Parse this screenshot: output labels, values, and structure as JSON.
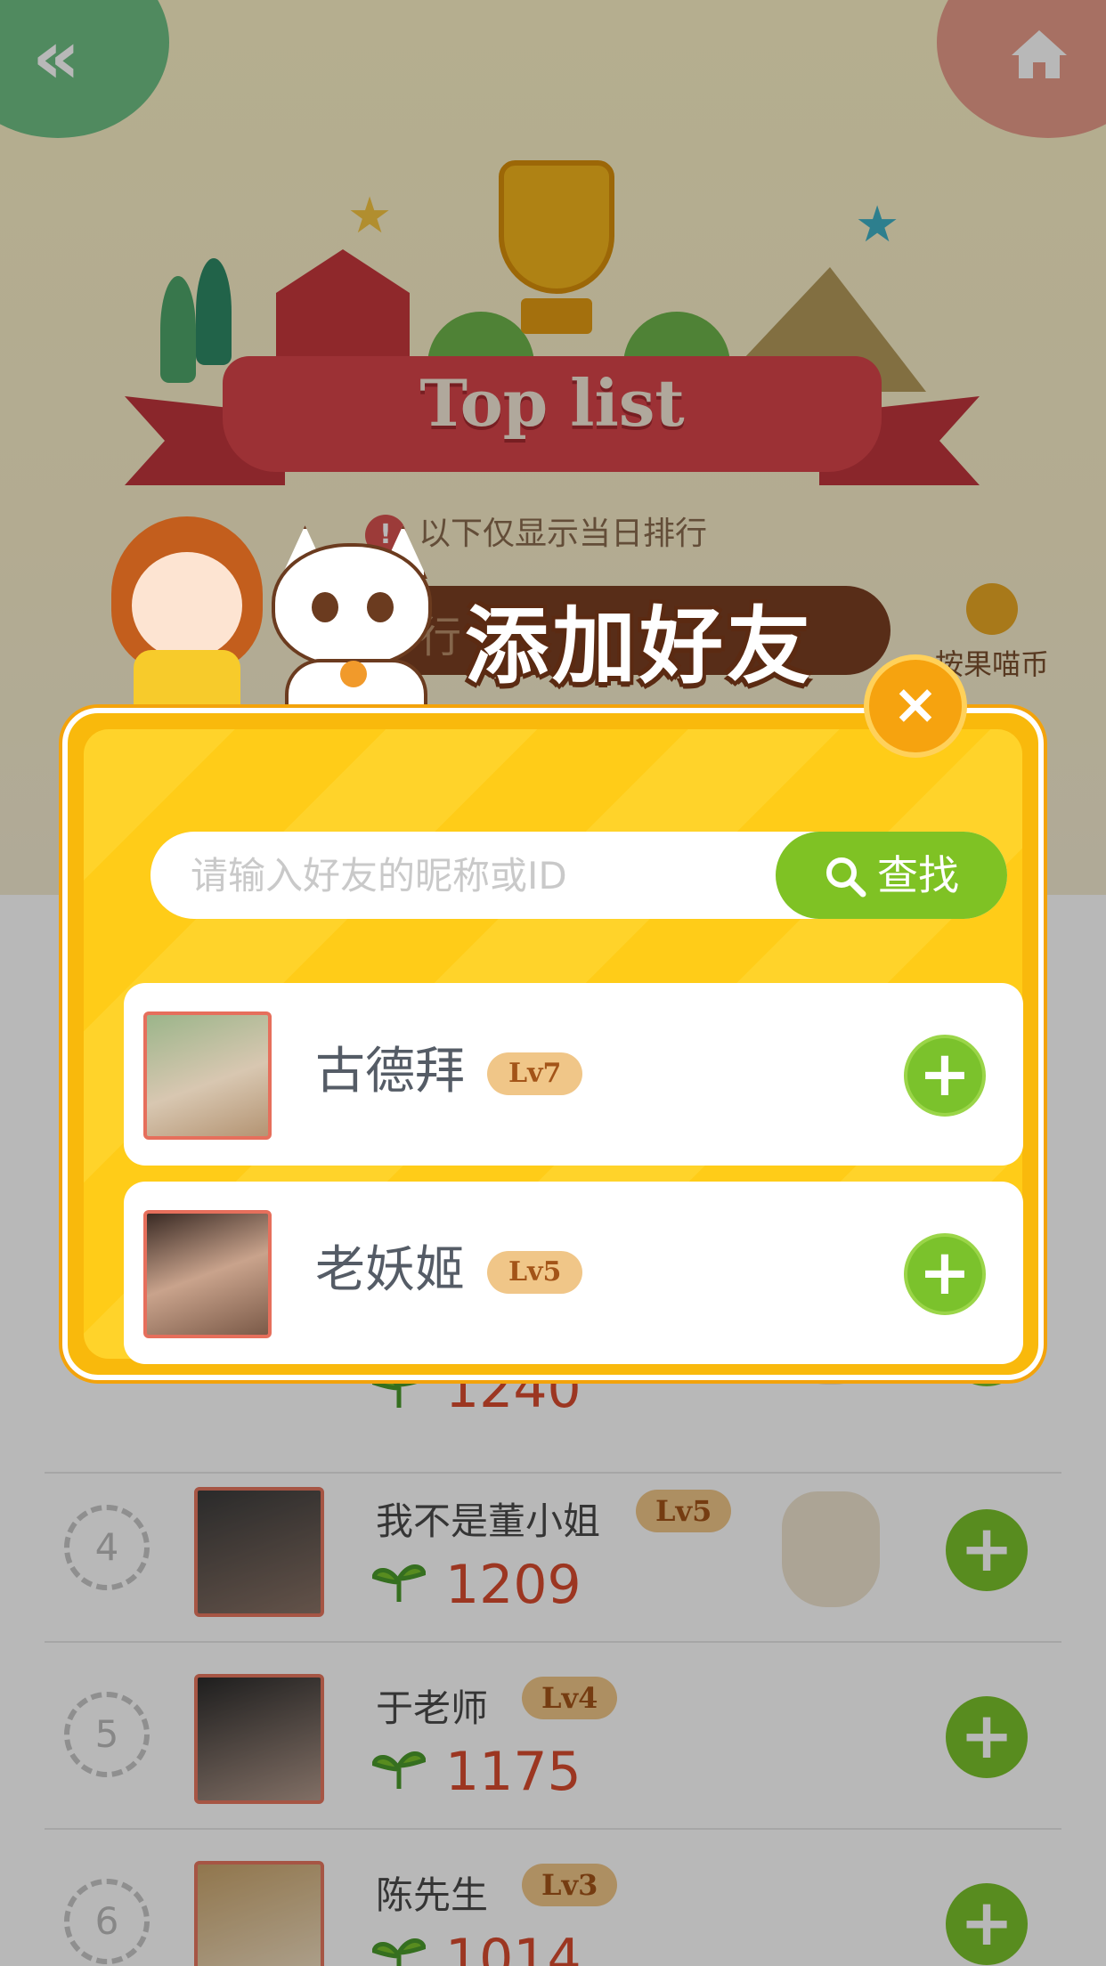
{
  "header": {
    "banner_title": "Top list",
    "note": "以下仅显示当日排行",
    "tab_label": "行",
    "reward_label": "按果喵币"
  },
  "leaderboard": {
    "rows": [
      {
        "rank": "",
        "name": "",
        "level": "",
        "score": "1240"
      },
      {
        "rank": "4",
        "name": "我不是董小姐",
        "level": "Lv5",
        "score": "1209"
      },
      {
        "rank": "5",
        "name": "于老师",
        "level": "Lv4",
        "score": "1175"
      },
      {
        "rank": "6",
        "name": "陈先生",
        "level": "Lv3",
        "score": "1014"
      }
    ]
  },
  "modal": {
    "title": "添加好友",
    "close_label": "×",
    "search_placeholder": "请输入好友的昵称或ID",
    "search_button": "查找",
    "results": [
      {
        "name": "古德拜",
        "level": "Lv7",
        "add_label": "+"
      },
      {
        "name": "老妖姬",
        "level": "Lv5",
        "add_label": "+"
      }
    ]
  },
  "icons": {
    "back": "double-chevron-left-icon",
    "home": "home-icon",
    "search": "search-icon",
    "close": "close-icon",
    "add": "plus-icon",
    "info": "info-icon",
    "sprout": "sprout-icon"
  },
  "colors": {
    "accent_green": "#7bc22c",
    "modal_yellow": "#ffd32a",
    "score_red": "#d84b2f",
    "level_badge": "#f0c688"
  }
}
